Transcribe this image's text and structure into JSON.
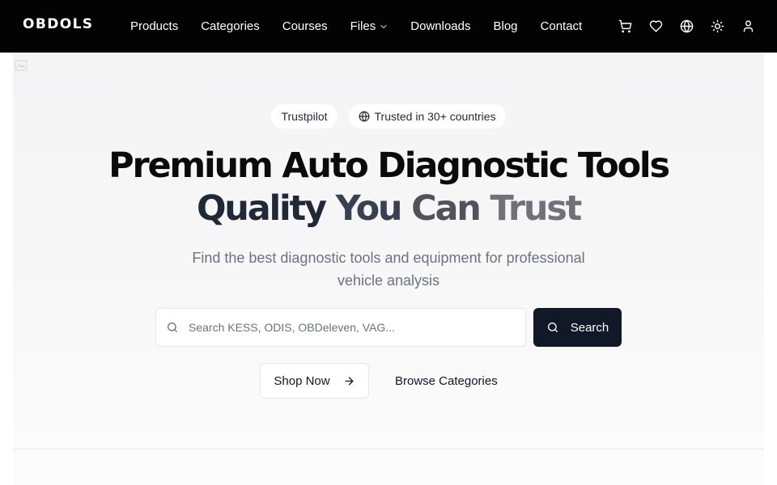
{
  "brand": {
    "logo": "OBDOLS"
  },
  "nav": {
    "links": [
      {
        "label": "Products"
      },
      {
        "label": "Categories"
      },
      {
        "label": "Courses"
      },
      {
        "label": "Files",
        "has_dropdown": true
      },
      {
        "label": "Downloads"
      },
      {
        "label": "Blog"
      },
      {
        "label": "Contact"
      }
    ],
    "icons": [
      "cart-icon",
      "heart-icon",
      "globe-icon",
      "sun-icon",
      "user-icon"
    ]
  },
  "hero": {
    "badges": [
      {
        "label": "Trustpilot"
      },
      {
        "label": "Trusted in 30+ countries",
        "icon": "globe-icon"
      }
    ],
    "headline_line1": "Premium Auto Diagnostic Tools",
    "headline_line2": [
      "Quality",
      "You",
      "Can",
      "Trust"
    ],
    "subtitle_line1": "Find the best diagnostic tools and equipment for professional",
    "subtitle_line2": "vehicle analysis",
    "search": {
      "placeholder": "Search KESS, ODIS, OBDeleven, VAG...",
      "value": "",
      "button_label": "Search"
    },
    "cta": {
      "primary_label": "Shop Now",
      "secondary_label": "Browse Categories"
    }
  },
  "colors": {
    "navbar_bg": "#030303",
    "search_button_bg": "#111827",
    "hero_bg": "#f4f4f5"
  }
}
